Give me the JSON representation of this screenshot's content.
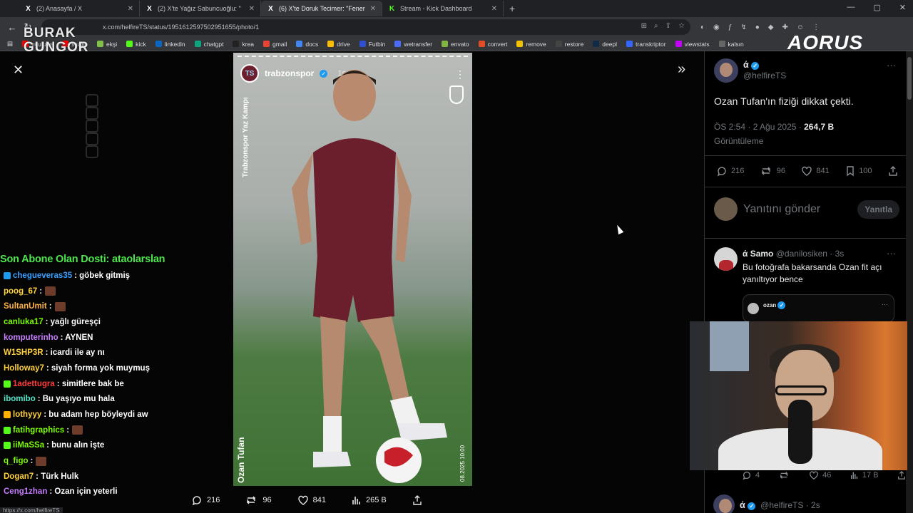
{
  "browser": {
    "tabs": [
      {
        "icon": "X",
        "label": "(2) Anasayfa / X",
        "active": false
      },
      {
        "icon": "X",
        "label": "(2) X'te Yağız Sabuncuoğlu: \"",
        "active": false
      },
      {
        "icon": "X",
        "label": "(6) X'te Doruk Tecimer: \"Fener",
        "active": true
      },
      {
        "icon": "K",
        "label": "Stream - Kick Dashboard",
        "active": false
      }
    ],
    "url": "x.com/helfireTS/status/1951612597502951655/photo/1",
    "bookmarks": [
      {
        "label": "youtube",
        "color": "#ff0000"
      },
      {
        "label": "studio",
        "color": "#ff0000"
      },
      {
        "label": "ekşi",
        "color": "#81c14b"
      },
      {
        "label": "kick",
        "color": "#53fc18"
      },
      {
        "label": "linkedin",
        "color": "#0a66c2"
      },
      {
        "label": "chatgpt",
        "color": "#10a37f"
      },
      {
        "label": "krea",
        "color": "#222222"
      },
      {
        "label": "gmail",
        "color": "#ea4335"
      },
      {
        "label": "docs",
        "color": "#4285f4"
      },
      {
        "label": "drive",
        "color": "#fbbc04"
      },
      {
        "label": "Futbin",
        "color": "#2f4fd1"
      },
      {
        "label": "wetransfer",
        "color": "#4a6cf7"
      },
      {
        "label": "envato",
        "color": "#81b441"
      },
      {
        "label": "convert",
        "color": "#e34c26"
      },
      {
        "label": "remove",
        "color": "#f2c200"
      },
      {
        "label": "restore",
        "color": "#444444"
      },
      {
        "label": "deepl",
        "color": "#0f2b46"
      },
      {
        "label": "transkriptor",
        "color": "#3366ff"
      },
      {
        "label": "viewstats",
        "color": "#c400ff"
      },
      {
        "label": "kalsın",
        "color": "#666666"
      }
    ]
  },
  "overlay": {
    "logo_line1": "BURAK",
    "logo_line2": "GUNGOR",
    "brand": "AORUS",
    "sub_alert": "Son Abone Olan Dosti: ataolarslan",
    "status_url": "https://x.com/helfireTS"
  },
  "chat": [
    {
      "name": "chegueveras35",
      "color": "#3aa0ff",
      "msg": ": göbek gitmiş",
      "badge": "#1d9bf0",
      "emote": false
    },
    {
      "name": "poog_67",
      "color": "#ffd23f",
      "msg": ":",
      "badge": "",
      "emote": true
    },
    {
      "name": "SultanUmit",
      "color": "#ffb347",
      "msg": ":",
      "badge": "",
      "emote": true
    },
    {
      "name": "canluka17",
      "color": "#7cfc00",
      "msg": ": yağlı güreşçi",
      "badge": "",
      "emote": false
    },
    {
      "name": "komputerinho",
      "color": "#c77dff",
      "msg": ": AYNEN",
      "badge": "",
      "emote": false
    },
    {
      "name": "W1SHP3R",
      "color": "#ffd23f",
      "msg": ": icardi ile ay nı",
      "badge": "",
      "emote": false
    },
    {
      "name": "Holloway7",
      "color": "#ffd23f",
      "msg": ": siyah forma yok muymuş",
      "badge": "",
      "emote": false
    },
    {
      "name": "1adettugra",
      "color": "#ff3b3b",
      "msg": ": simitlere bak be",
      "badge": "#53fc18",
      "emote": false
    },
    {
      "name": "ibomibo",
      "color": "#4ee6c9",
      "msg": ": Bu yaşıyo mu hala",
      "badge": "",
      "emote": false
    },
    {
      "name": "lothyyy",
      "color": "#ffd23f",
      "msg": ": bu adam hep böyleydi aw",
      "badge": "#ffb000",
      "emote": false
    },
    {
      "name": "fatihgraphics",
      "color": "#7cfc00",
      "msg": ":",
      "badge": "#53fc18",
      "emote": true
    },
    {
      "name": "iiMaSSa",
      "color": "#7cfc00",
      "msg": ": bunu alın işte",
      "badge": "#53fc18",
      "emote": false
    },
    {
      "name": "q_figo",
      "color": "#7cfc00",
      "msg": ":",
      "badge": "",
      "emote": true
    },
    {
      "name": "Dogan7",
      "color": "#ffd23f",
      "msg": ": Türk Hulk",
      "badge": "",
      "emote": false
    },
    {
      "name": "Ceng1zhan",
      "color": "#c77dff",
      "msg": ": Ozan için yeterli",
      "badge": "",
      "emote": false
    }
  ],
  "story": {
    "user": "trabzonspor",
    "time": "1s",
    "side_text": "Trabzonspor Yaz Kampı",
    "player_name": "Ozan Tufan",
    "date": "08.2025 10.00"
  },
  "image_actions": {
    "replies": "216",
    "reposts": "96",
    "likes": "841",
    "views": "265 B"
  },
  "tweet": {
    "display_name": "ά",
    "handle": "@helfireTS",
    "text": "Ozan Tufan'ın fiziği dikkat çekti.",
    "time": "ÖS 2:54 · 2 Ağu 2025 · ",
    "views_count": "264,7 B",
    "views_label": "Görüntüleme",
    "replies": "216",
    "reposts": "96",
    "likes": "841",
    "bookmarks": "100",
    "reply_placeholder": "Yanıtını gönder",
    "reply_button": "Yanıtla"
  },
  "reply1": {
    "name": "ά Samo",
    "handle": "@danilosiken · 3s",
    "text": "Bu fotoğrafa bakarsanda Ozan fit açı yanıltıyor bence",
    "embed_name": "ozan"
  },
  "reply1_actions": {
    "replies": "4",
    "likes": "46",
    "views": "17 B"
  },
  "reply2": {
    "name": "ά",
    "handle": "@helfireTS · 2s"
  }
}
